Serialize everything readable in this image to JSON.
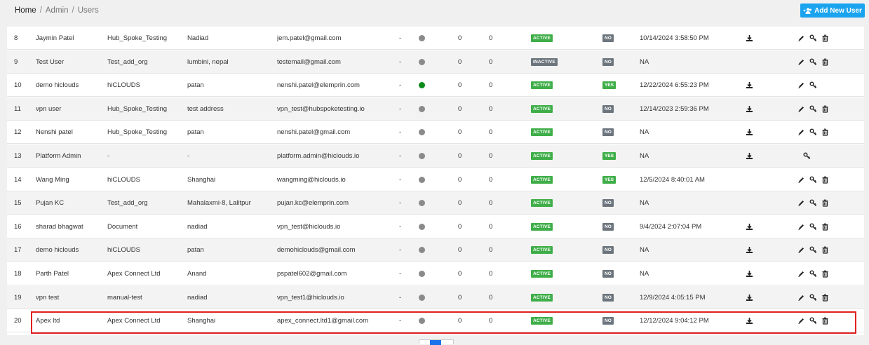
{
  "breadcrumb": {
    "home": "Home",
    "admin": "Admin",
    "users": "Users",
    "sep": "/"
  },
  "header": {
    "add_button_label": "Add New User"
  },
  "rows": [
    {
      "id": "8",
      "name": "Jaymin Patel",
      "org": "Hub_Spoke_Testing",
      "address": "Nadiad",
      "email": "jem.patel@gmail.com",
      "dash": "-",
      "online": false,
      "c1": "0",
      "c2": "0",
      "status": "ACTIVE",
      "flag": "NO",
      "last": "10/14/2024 3:58:50 PM",
      "download": true,
      "edit": true,
      "key": true,
      "del": true
    },
    {
      "id": "9",
      "name": "Test User",
      "org": "Test_add_org",
      "address": "lumbini, nepal",
      "email": "testemail@gmail.com",
      "dash": "-",
      "online": false,
      "c1": "0",
      "c2": "0",
      "status": "INACTIVE",
      "flag": "NO",
      "last": "NA",
      "download": false,
      "edit": true,
      "key": true,
      "del": true
    },
    {
      "id": "10",
      "name": "demo hiclouds",
      "org": "hiCLOUDS",
      "address": "patan",
      "email": "nenshi.patel@elemprin.com",
      "dash": "-",
      "online": true,
      "c1": "0",
      "c2": "0",
      "status": "ACTIVE",
      "flag": "YES",
      "last": "12/22/2024 6:55:23 PM",
      "download": true,
      "edit": true,
      "key": true,
      "del": false
    },
    {
      "id": "11",
      "name": "vpn user",
      "org": "Hub_Spoke_Testing",
      "address": "test address",
      "email": "vpn_test@hubspoketesting.io",
      "dash": "-",
      "online": false,
      "c1": "0",
      "c2": "0",
      "status": "ACTIVE",
      "flag": "NO",
      "last": "12/14/2023 2:59:36 PM",
      "download": true,
      "edit": true,
      "key": true,
      "del": true
    },
    {
      "id": "12",
      "name": "Nenshi patel",
      "org": "Hub_Spoke_Testing",
      "address": "patan",
      "email": "nenshi.patel@gmail.com",
      "dash": "-",
      "online": false,
      "c1": "0",
      "c2": "0",
      "status": "ACTIVE",
      "flag": "NO",
      "last": "NA",
      "download": true,
      "edit": true,
      "key": true,
      "del": true
    },
    {
      "id": "13",
      "name": "Platform Admin",
      "org": "-",
      "address": "-",
      "email": "platform.admin@hiclouds.io",
      "dash": "-",
      "online": false,
      "c1": "0",
      "c2": "0",
      "status": "ACTIVE",
      "flag": "YES",
      "last": "NA",
      "download": true,
      "edit": false,
      "key": true,
      "del": false
    },
    {
      "id": "14",
      "name": "Wang Ming",
      "org": "hiCLOUDS",
      "address": "Shanghai",
      "email": "wangming@hiclouds.io",
      "dash": "-",
      "online": false,
      "c1": "0",
      "c2": "0",
      "status": "ACTIVE",
      "flag": "YES",
      "last": "12/5/2024 8:40:01 AM",
      "download": false,
      "edit": true,
      "key": true,
      "del": true
    },
    {
      "id": "15",
      "name": "Pujan KC",
      "org": "Test_add_org",
      "address": "Mahalaxmi-8, Lalitpur",
      "email": "pujan.kc@elemprin.com",
      "dash": "-",
      "online": false,
      "c1": "0",
      "c2": "0",
      "status": "ACTIVE",
      "flag": "NO",
      "last": "NA",
      "download": false,
      "edit": true,
      "key": true,
      "del": true
    },
    {
      "id": "16",
      "name": "sharad bhagwat",
      "org": "Document",
      "address": "nadiad",
      "email": "vpn_test@hiclouds.io",
      "dash": "-",
      "online": false,
      "c1": "0",
      "c2": "0",
      "status": "ACTIVE",
      "flag": "NO",
      "last": "9/4/2024 2:07:04 PM",
      "download": true,
      "edit": true,
      "key": true,
      "del": true
    },
    {
      "id": "17",
      "name": "demo hiclouds",
      "org": "hiCLOUDS",
      "address": "patan",
      "email": "demohiclouds@gmail.com",
      "dash": "-",
      "online": false,
      "c1": "0",
      "c2": "0",
      "status": "ACTIVE",
      "flag": "NO",
      "last": "NA",
      "download": true,
      "edit": true,
      "key": true,
      "del": true
    },
    {
      "id": "18",
      "name": "Parth Patel",
      "org": "Apex Connect Ltd",
      "address": "Anand",
      "email": "pspatel602@gmail.com",
      "dash": "-",
      "online": false,
      "c1": "0",
      "c2": "0",
      "status": "ACTIVE",
      "flag": "NO",
      "last": "NA",
      "download": true,
      "edit": true,
      "key": true,
      "del": true
    },
    {
      "id": "19",
      "name": "vpn test",
      "org": "manual-test",
      "address": "nadiad",
      "email": "vpn_test1@hiclouds.io",
      "dash": "-",
      "online": false,
      "c1": "0",
      "c2": "0",
      "status": "ACTIVE",
      "flag": "NO",
      "last": "12/9/2024 4:05:15 PM",
      "download": true,
      "edit": true,
      "key": true,
      "del": true
    },
    {
      "id": "20",
      "name": "Apex ltd",
      "org": "Apex Connect Ltd",
      "address": "Shanghai",
      "email": "apex_connect.ltd1@gmail.com",
      "dash": "-",
      "online": false,
      "c1": "0",
      "c2": "0",
      "status": "ACTIVE",
      "flag": "NO",
      "last": "12/12/2024 9:04:12 PM",
      "download": true,
      "edit": true,
      "key": true,
      "del": true
    }
  ],
  "colors": {
    "accent": "#1aa3ef",
    "active": "#3fae49",
    "inactive": "#6c757d",
    "online": "#0a8a1a",
    "offline": "#8a8a8a",
    "highlight": "#e02020"
  }
}
